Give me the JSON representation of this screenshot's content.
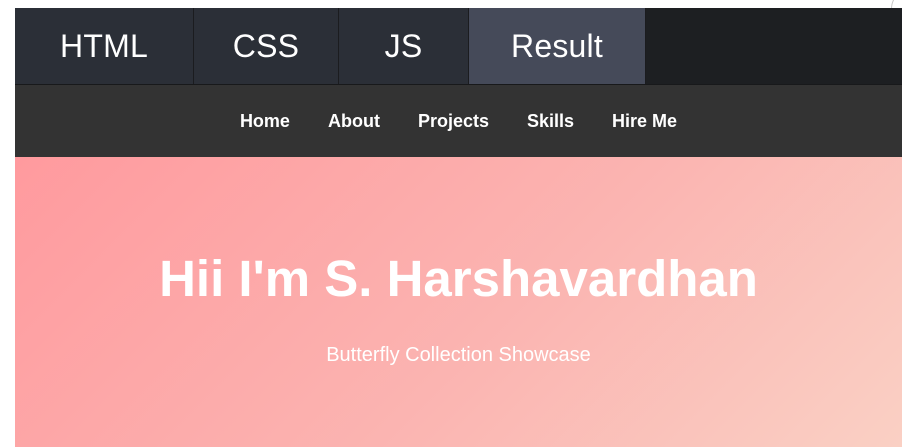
{
  "editor_tabs": [
    {
      "label": "HTML",
      "active": false
    },
    {
      "label": "CSS",
      "active": false
    },
    {
      "label": "JS",
      "active": false
    },
    {
      "label": "Result",
      "active": true
    }
  ],
  "nav": {
    "items": [
      "Home",
      "About",
      "Projects",
      "Skills",
      "Hire Me"
    ]
  },
  "hero": {
    "title": "Hii I'm S. Harshavardhan",
    "subtitle": "Butterfly Collection Showcase"
  },
  "colors": {
    "tab_bar_bg": "#1d1f22",
    "tab_bg": "#2b2f37",
    "tab_active_bg": "#454a59",
    "nav_bg": "#333333",
    "hero_gradient_start": "#ff9a9e",
    "hero_gradient_end": "#fad0c4"
  }
}
